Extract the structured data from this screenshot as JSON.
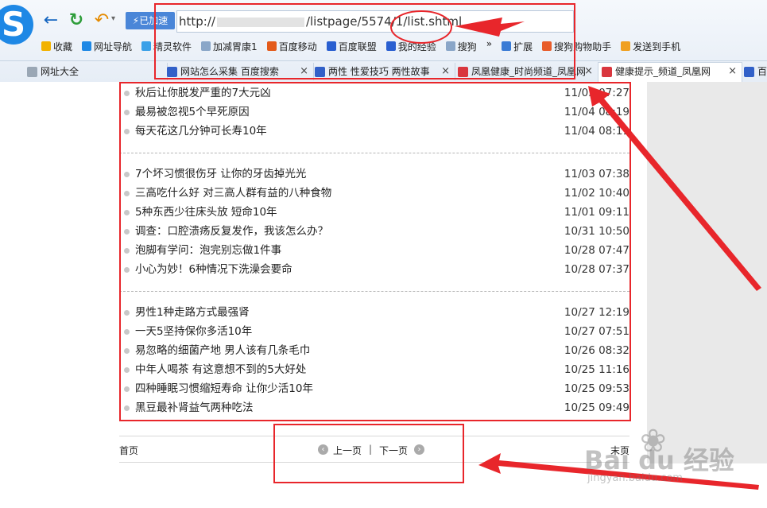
{
  "browser": {
    "accelerated_label": "已加速",
    "address_prefix": "http://",
    "address_suffix": "/listpage/5574/1/list.shtml",
    "bookmarks": [
      {
        "label": "收藏",
        "icon": "star-icon",
        "color": "#f2b200"
      },
      {
        "label": "网址导航",
        "icon": "sogou-icon",
        "color": "#1e88e5"
      },
      {
        "label": "精灵软件",
        "icon": "gem-icon",
        "color": "#3aa0e8"
      },
      {
        "label": "加减胃康1",
        "icon": "page-icon",
        "color": "#8aa6c8"
      },
      {
        "label": "百度移动",
        "icon": "baidu-icon",
        "color": "#e35a1a"
      },
      {
        "label": "百度联盟",
        "icon": "paw-icon",
        "color": "#2a5fd0"
      },
      {
        "label": "我的经验",
        "icon": "paw-icon",
        "color": "#2a5fd0"
      },
      {
        "label": "搜狗",
        "icon": "page-icon",
        "color": "#8aa6c8"
      },
      {
        "label": "扩展",
        "icon": "grid-icon",
        "color": "#3a7bd5"
      },
      {
        "label": "搜狗购物助手",
        "icon": "cart-icon",
        "color": "#e85c2a"
      },
      {
        "label": "发送到手机",
        "icon": "phone-icon",
        "color": "#f0a020"
      }
    ],
    "more_glyph": "»",
    "tabs": [
      {
        "label": "网址大全",
        "icon": "globe-icon"
      },
      {
        "label": "网站怎么采集 百度搜索",
        "icon": "paw-icon"
      },
      {
        "label": "两性 性爱技巧 两性故事",
        "icon": "page-icon"
      },
      {
        "label": "凤凰健康_时尚频道_凤凰网",
        "icon": "phoenix-icon"
      },
      {
        "label": "健康提示_频道_凤凰网",
        "icon": "phoenix-icon"
      },
      {
        "label": "百",
        "icon": "paw-icon"
      }
    ],
    "close_glyph": "×"
  },
  "groups": [
    [
      {
        "title": "秋后让你脱发严重的7大元凶",
        "date": "11/05 07:27"
      },
      {
        "title": "最易被忽视5个早死原因",
        "date": "11/04 08:19"
      },
      {
        "title": "每天花这几分钟可长寿10年",
        "date": "11/04 08:11"
      }
    ],
    [
      {
        "title": "7个坏习惯很伤牙 让你的牙齿掉光光",
        "date": "11/03 07:38"
      },
      {
        "title": "三高吃什么好 对三高人群有益的八种食物",
        "date": "11/02 10:40"
      },
      {
        "title": "5种东西少往床头放 短命10年",
        "date": "11/01 09:11"
      },
      {
        "title": "调查：口腔溃疡反复发作，我该怎么办？",
        "date": "10/31 10:50"
      },
      {
        "title": "泡脚有学问：泡完别忘做1件事",
        "date": "10/28 07:47"
      },
      {
        "title": "小心为妙！6种情况下洗澡会要命",
        "date": "10/28 07:37"
      }
    ],
    [
      {
        "title": "男性1种走路方式最强肾",
        "date": "10/27 12:19"
      },
      {
        "title": "一天5坚持保你多活10年",
        "date": "10/27 07:51"
      },
      {
        "title": "易忽略的细菌产地 男人该有几条毛巾",
        "date": "10/26 08:32"
      },
      {
        "title": "中年人喝茶 有这意想不到的5大好处",
        "date": "10/25 11:16"
      },
      {
        "title": "四种睡眠习惯缩短寿命 让你少活10年",
        "date": "10/25 09:53"
      },
      {
        "title": "黑豆最补肾益气两种吃法",
        "date": "10/25 09:49"
      }
    ]
  ],
  "pager": {
    "first": "首页",
    "prev": "上一页",
    "separator": "|",
    "next": "下一页",
    "last": "末页"
  },
  "watermark": {
    "text": "Bai du 经验",
    "url": "jingyan.baidu.com"
  },
  "colors": {
    "annotation_red": "#e8262b",
    "accent_blue": "#4a86d8"
  }
}
